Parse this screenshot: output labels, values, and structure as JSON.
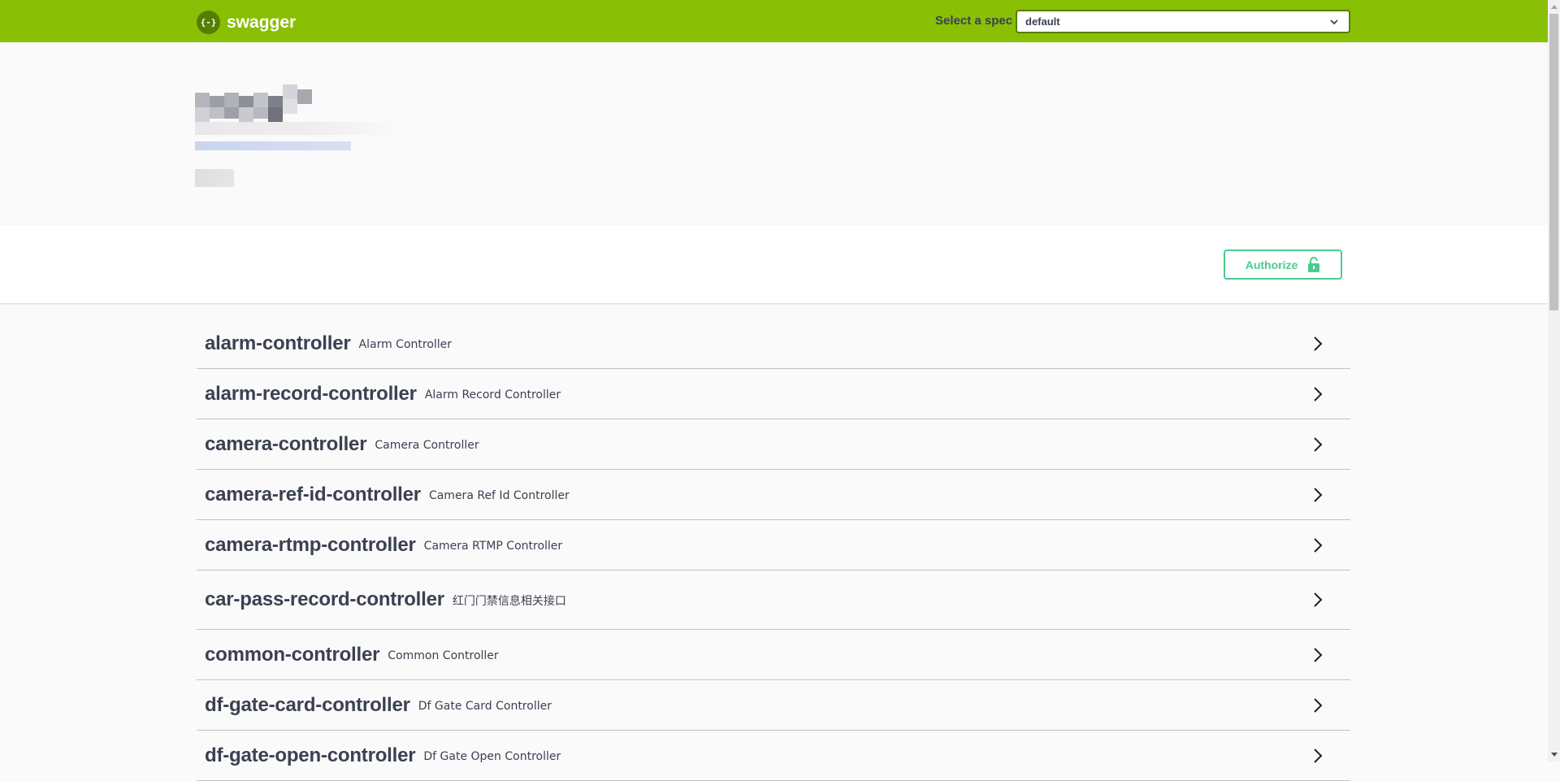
{
  "topbar": {
    "logo_text": "swagger",
    "logo_mark": "{-}",
    "spec_label": "Select a spec",
    "spec_selected": "default"
  },
  "scheme": {
    "authorize_label": "Authorize"
  },
  "tags": [
    {
      "name": "alarm-controller",
      "description": "Alarm Controller"
    },
    {
      "name": "alarm-record-controller",
      "description": "Alarm Record Controller"
    },
    {
      "name": "camera-controller",
      "description": "Camera Controller"
    },
    {
      "name": "camera-ref-id-controller",
      "description": "Camera Ref Id Controller"
    },
    {
      "name": "camera-rtmp-controller",
      "description": "Camera RTMP Controller"
    },
    {
      "name": "car-pass-record-controller",
      "description": "红门门禁信息相关接口"
    },
    {
      "name": "common-controller",
      "description": "Common Controller"
    },
    {
      "name": "df-gate-card-controller",
      "description": "Df Gate Card Controller"
    },
    {
      "name": "df-gate-open-controller",
      "description": "Df Gate Open Controller"
    }
  ],
  "colors": {
    "topbar": "#89bf04",
    "authorize": "#49cc90",
    "text": "#3b4151"
  }
}
